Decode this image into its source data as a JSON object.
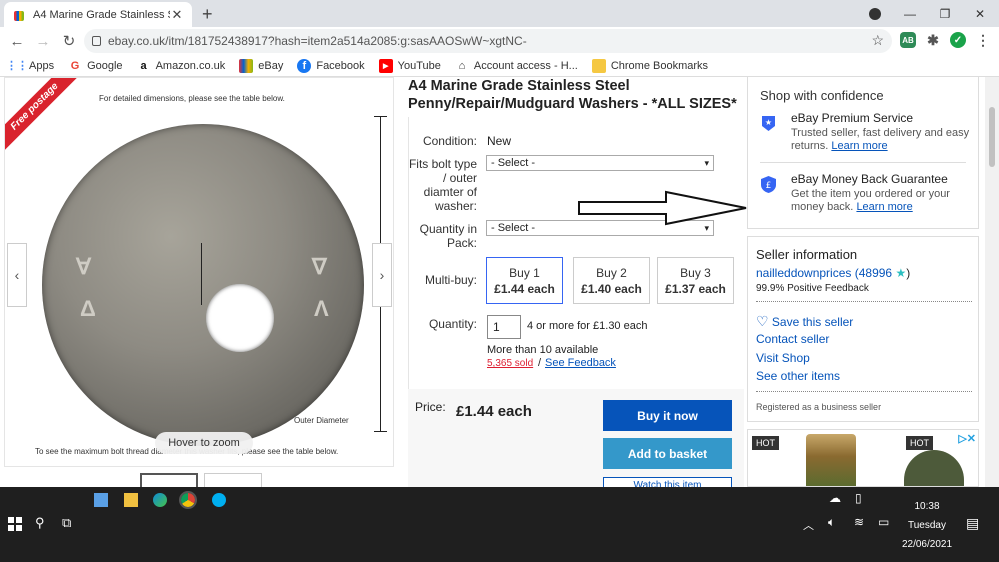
{
  "browser": {
    "tab_title": "A4 Marine Grade Stainless Steel P",
    "url": "ebay.co.uk/itm/181752438917?hash=item2a514a2085:g:sasAAOSwW~xgtNC-",
    "bookmarks": [
      "Apps",
      "Google",
      "Amazon.co.uk",
      "eBay",
      "Facebook",
      "YouTube",
      "Account access - H...",
      "Chrome Bookmarks"
    ],
    "extension_badge": "AB"
  },
  "gallery": {
    "banner": "Free postage",
    "note_top": "For detailed dimensions, please see the table below.",
    "note_bottom": "To see the maximum bolt thread diameter this washer fits, please see the table below.",
    "outer_label": "Outer Diameter",
    "hover_zoom": "Hover to zoom"
  },
  "product": {
    "title": "A4 Marine Grade Stainless Steel Penny/Repair/Mudguard Washers - *ALL SIZES*",
    "condition_label": "Condition:",
    "condition_value": "New",
    "fits_label": "Fits bolt type / outer diamter of washer:",
    "fits_select": "- Select -",
    "qty_pack_label": "Quantity in Pack:",
    "qty_pack_select": "- Select -",
    "multibuy_label": "Multi-buy:",
    "multibuy": [
      {
        "qty": "Buy 1",
        "price": "£1.44 each"
      },
      {
        "qty": "Buy 2",
        "price": "£1.40 each"
      },
      {
        "qty": "Buy 3",
        "price": "£1.37 each"
      }
    ],
    "quantity_label": "Quantity:",
    "quantity_value": "1",
    "bulk_offer": "4 or more for £1.30 each",
    "available": "More than 10 available",
    "sold": "5,365 sold",
    "separator": "/",
    "feedback_link": "See Feedback",
    "price_label": "Price:",
    "price": "£1.44 each",
    "buy_now": "Buy it now",
    "add_basket": "Add to basket",
    "watch": "Watch this item"
  },
  "confidence": {
    "heading": "Shop with confidence",
    "items": [
      {
        "title": "eBay Premium Service",
        "desc": "Trusted seller, fast delivery and easy returns.",
        "link": "Learn more"
      },
      {
        "title": "eBay Money Back Guarantee",
        "desc": "Get the item you ordered or your money back.",
        "link": "Learn more"
      }
    ]
  },
  "seller": {
    "heading": "Seller information",
    "name": "nailleddownprices",
    "score": "(48996",
    "score_close": ")",
    "feedback": "99.9% Positive Feedback",
    "save": "Save this seller",
    "contact": "Contact seller",
    "visit": "Visit Shop",
    "other": "See other items",
    "registered": "Registered as a business seller"
  },
  "ad": {
    "hot1": "HOT",
    "hot2": "HOT",
    "choice": "▷✕"
  },
  "taskbar": {
    "time": "10:38",
    "day": "Tuesday",
    "date": "22/06/2021"
  },
  "colors": {
    "ebay_blue": "#0654ba",
    "basket_blue": "#3498ca",
    "taskbar": "#1f1f1f"
  }
}
